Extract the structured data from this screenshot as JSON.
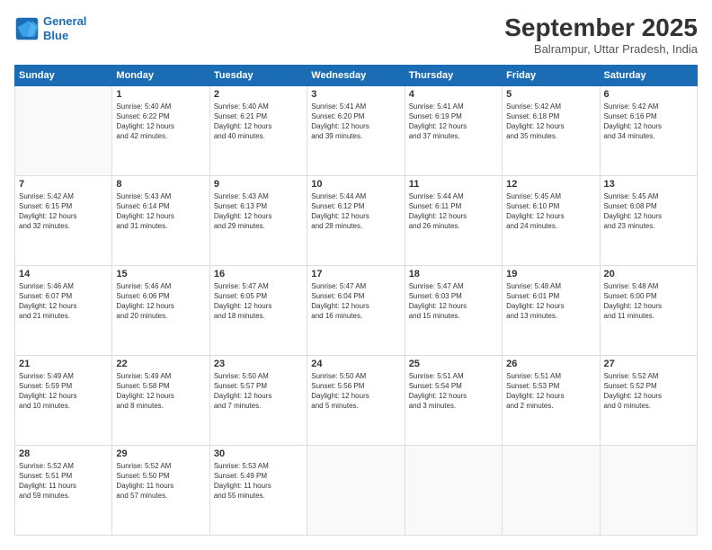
{
  "header": {
    "logo_line1": "General",
    "logo_line2": "Blue",
    "month": "September 2025",
    "location": "Balrampur, Uttar Pradesh, India"
  },
  "weekdays": [
    "Sunday",
    "Monday",
    "Tuesday",
    "Wednesday",
    "Thursday",
    "Friday",
    "Saturday"
  ],
  "weeks": [
    [
      {
        "day": "",
        "info": ""
      },
      {
        "day": "1",
        "info": "Sunrise: 5:40 AM\nSunset: 6:22 PM\nDaylight: 12 hours\nand 42 minutes."
      },
      {
        "day": "2",
        "info": "Sunrise: 5:40 AM\nSunset: 6:21 PM\nDaylight: 12 hours\nand 40 minutes."
      },
      {
        "day": "3",
        "info": "Sunrise: 5:41 AM\nSunset: 6:20 PM\nDaylight: 12 hours\nand 39 minutes."
      },
      {
        "day": "4",
        "info": "Sunrise: 5:41 AM\nSunset: 6:19 PM\nDaylight: 12 hours\nand 37 minutes."
      },
      {
        "day": "5",
        "info": "Sunrise: 5:42 AM\nSunset: 6:18 PM\nDaylight: 12 hours\nand 35 minutes."
      },
      {
        "day": "6",
        "info": "Sunrise: 5:42 AM\nSunset: 6:16 PM\nDaylight: 12 hours\nand 34 minutes."
      }
    ],
    [
      {
        "day": "7",
        "info": "Sunrise: 5:42 AM\nSunset: 6:15 PM\nDaylight: 12 hours\nand 32 minutes."
      },
      {
        "day": "8",
        "info": "Sunrise: 5:43 AM\nSunset: 6:14 PM\nDaylight: 12 hours\nand 31 minutes."
      },
      {
        "day": "9",
        "info": "Sunrise: 5:43 AM\nSunset: 6:13 PM\nDaylight: 12 hours\nand 29 minutes."
      },
      {
        "day": "10",
        "info": "Sunrise: 5:44 AM\nSunset: 6:12 PM\nDaylight: 12 hours\nand 28 minutes."
      },
      {
        "day": "11",
        "info": "Sunrise: 5:44 AM\nSunset: 6:11 PM\nDaylight: 12 hours\nand 26 minutes."
      },
      {
        "day": "12",
        "info": "Sunrise: 5:45 AM\nSunset: 6:10 PM\nDaylight: 12 hours\nand 24 minutes."
      },
      {
        "day": "13",
        "info": "Sunrise: 5:45 AM\nSunset: 6:08 PM\nDaylight: 12 hours\nand 23 minutes."
      }
    ],
    [
      {
        "day": "14",
        "info": "Sunrise: 5:46 AM\nSunset: 6:07 PM\nDaylight: 12 hours\nand 21 minutes."
      },
      {
        "day": "15",
        "info": "Sunrise: 5:46 AM\nSunset: 6:06 PM\nDaylight: 12 hours\nand 20 minutes."
      },
      {
        "day": "16",
        "info": "Sunrise: 5:47 AM\nSunset: 6:05 PM\nDaylight: 12 hours\nand 18 minutes."
      },
      {
        "day": "17",
        "info": "Sunrise: 5:47 AM\nSunset: 6:04 PM\nDaylight: 12 hours\nand 16 minutes."
      },
      {
        "day": "18",
        "info": "Sunrise: 5:47 AM\nSunset: 6:03 PM\nDaylight: 12 hours\nand 15 minutes."
      },
      {
        "day": "19",
        "info": "Sunrise: 5:48 AM\nSunset: 6:01 PM\nDaylight: 12 hours\nand 13 minutes."
      },
      {
        "day": "20",
        "info": "Sunrise: 5:48 AM\nSunset: 6:00 PM\nDaylight: 12 hours\nand 11 minutes."
      }
    ],
    [
      {
        "day": "21",
        "info": "Sunrise: 5:49 AM\nSunset: 5:59 PM\nDaylight: 12 hours\nand 10 minutes."
      },
      {
        "day": "22",
        "info": "Sunrise: 5:49 AM\nSunset: 5:58 PM\nDaylight: 12 hours\nand 8 minutes."
      },
      {
        "day": "23",
        "info": "Sunrise: 5:50 AM\nSunset: 5:57 PM\nDaylight: 12 hours\nand 7 minutes."
      },
      {
        "day": "24",
        "info": "Sunrise: 5:50 AM\nSunset: 5:56 PM\nDaylight: 12 hours\nand 5 minutes."
      },
      {
        "day": "25",
        "info": "Sunrise: 5:51 AM\nSunset: 5:54 PM\nDaylight: 12 hours\nand 3 minutes."
      },
      {
        "day": "26",
        "info": "Sunrise: 5:51 AM\nSunset: 5:53 PM\nDaylight: 12 hours\nand 2 minutes."
      },
      {
        "day": "27",
        "info": "Sunrise: 5:52 AM\nSunset: 5:52 PM\nDaylight: 12 hours\nand 0 minutes."
      }
    ],
    [
      {
        "day": "28",
        "info": "Sunrise: 5:52 AM\nSunset: 5:51 PM\nDaylight: 11 hours\nand 59 minutes."
      },
      {
        "day": "29",
        "info": "Sunrise: 5:52 AM\nSunset: 5:50 PM\nDaylight: 11 hours\nand 57 minutes."
      },
      {
        "day": "30",
        "info": "Sunrise: 5:53 AM\nSunset: 5:49 PM\nDaylight: 11 hours\nand 55 minutes."
      },
      {
        "day": "",
        "info": ""
      },
      {
        "day": "",
        "info": ""
      },
      {
        "day": "",
        "info": ""
      },
      {
        "day": "",
        "info": ""
      }
    ]
  ]
}
